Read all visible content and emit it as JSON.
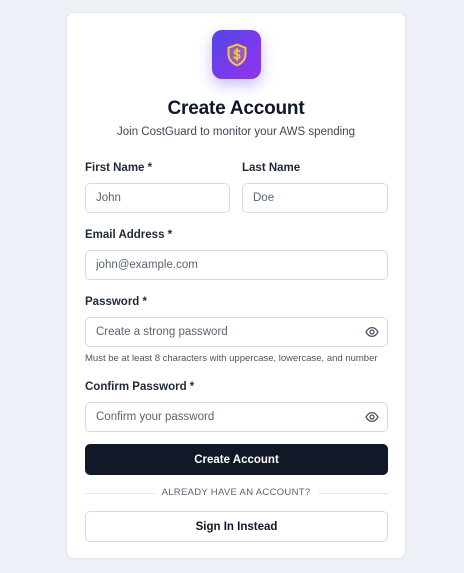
{
  "header": {
    "logo_icon": "shield-dollar-icon",
    "title": "Create Account",
    "subtitle": "Join CostGuard to monitor your AWS spending"
  },
  "form": {
    "first_name": {
      "label": "First Name *",
      "placeholder": "John",
      "value": ""
    },
    "last_name": {
      "label": "Last Name",
      "placeholder": "Doe",
      "value": ""
    },
    "email": {
      "label": "Email Address *",
      "placeholder": "john@example.com",
      "value": ""
    },
    "password": {
      "label": "Password *",
      "placeholder": "Create a strong password",
      "value": "",
      "hint": "Must be at least 8 characters with uppercase, lowercase, and number",
      "toggle_icon": "eye-icon"
    },
    "confirm_password": {
      "label": "Confirm Password *",
      "placeholder": "Confirm your password",
      "value": "",
      "toggle_icon": "eye-icon"
    },
    "submit_label": "Create Account"
  },
  "footer": {
    "divider_text": "ALREADY HAVE AN ACCOUNT?",
    "sign_in_label": "Sign In Instead"
  },
  "colors": {
    "primary_button": "#111827",
    "logo_gradient_start": "#4f46e5",
    "logo_gradient_end": "#9333ea",
    "shield_icon": "#f5c542",
    "page_background": "#eef1f7"
  }
}
